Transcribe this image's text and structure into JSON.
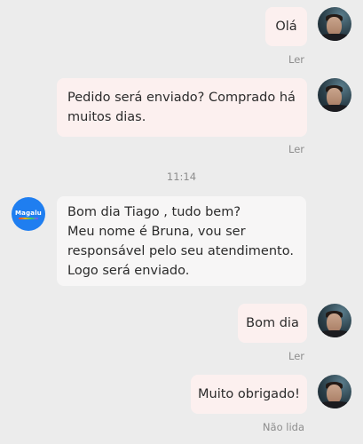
{
  "messages": [
    {
      "direction": "out",
      "text": "Olá",
      "status": "Ler"
    },
    {
      "direction": "out",
      "text": "Pedido será enviado? Comprado há\nmuitos dias.",
      "status": "Ler"
    },
    {
      "timestamp": "11:14"
    },
    {
      "direction": "in",
      "sender_logo": "Magalu",
      "text": "Bom dia Tiago , tudo bem?\nMeu nome é Bruna, vou ser\nresponsável pelo seu atendimento.\nLogo será enviado."
    },
    {
      "direction": "out",
      "text": "Bom dia",
      "status": "Ler"
    },
    {
      "direction": "out",
      "text": "Muito obrigado!",
      "status": "Não lida"
    }
  ],
  "colors": {
    "background": "#ececec",
    "outgoing_bubble": "#fcf0ef",
    "incoming_bubble": "#f7f6f6",
    "brand_blue": "#1f7ef0",
    "muted_text": "#8d8d8d"
  },
  "icons": {
    "user_avatar": "user-photo-avatar",
    "brand_avatar": "magalu-logo-avatar"
  }
}
